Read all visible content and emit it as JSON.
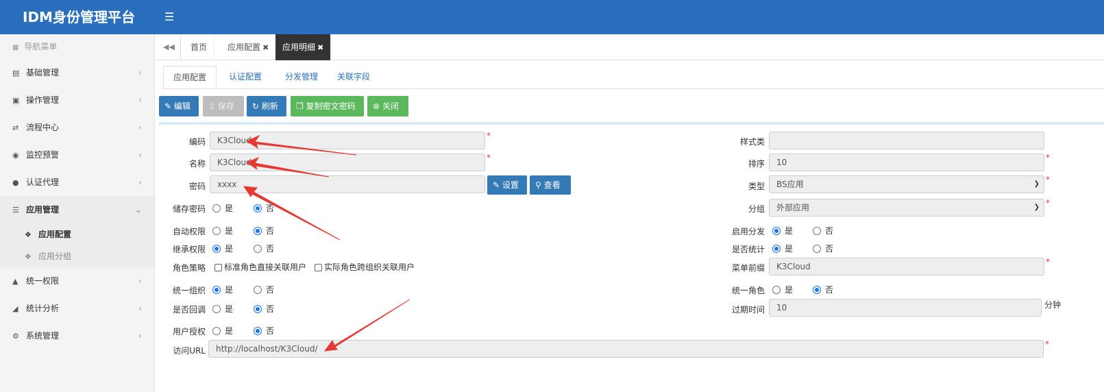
{
  "app": {
    "title": "IDM身份管理平台",
    "menu_icon": "hamburger-icon"
  },
  "sidebar": {
    "header": "导航菜单",
    "items": [
      {
        "label": "基础管理",
        "icon": "id-card-icon"
      },
      {
        "label": "操作管理",
        "icon": "book-icon"
      },
      {
        "label": "流程中心",
        "icon": "shuffle-icon"
      },
      {
        "label": "监控预警",
        "icon": "eye-icon"
      },
      {
        "label": "认证代理",
        "icon": "users-icon"
      },
      {
        "label": "应用管理",
        "icon": "list-icon",
        "expanded": true
      },
      {
        "label": "统一权限",
        "icon": "sitemap-icon"
      },
      {
        "label": "统计分析",
        "icon": "chart-icon"
      },
      {
        "label": "系统管理",
        "icon": "cogs-icon"
      }
    ],
    "subitems": [
      {
        "label": "应用配置",
        "active": true
      },
      {
        "label": "应用分组",
        "active": false
      }
    ]
  },
  "tabs": {
    "back_icon": "double-left-icon",
    "items": [
      {
        "label": "首页",
        "closable": false
      },
      {
        "label": "应用配置",
        "closable": true
      },
      {
        "label": "应用明细",
        "closable": true,
        "active": true
      }
    ],
    "close_glyph": "✖"
  },
  "subtabs": [
    "应用配置",
    "认证配置",
    "分发管理",
    "关联字段"
  ],
  "toolbar": {
    "edit": "编辑",
    "save": "保存",
    "refresh": "刷新",
    "copy_cipher": "复制密文密码",
    "close": "关闭"
  },
  "form": {
    "code": {
      "label": "编码",
      "value": "K3Cloud",
      "required": true
    },
    "name": {
      "label": "名称",
      "value": "K3Cloud",
      "required": true
    },
    "password": {
      "label": "密码",
      "value": "xxxx",
      "set_button": "设置",
      "view_button": "查看"
    },
    "store_password": {
      "label": "储存密码",
      "selected": "否"
    },
    "auto_permission": {
      "label": "自动权限",
      "selected": "否"
    },
    "inherit_permission": {
      "label": "继承权限",
      "selected": "是"
    },
    "role_strategy": {
      "label": "角色策略",
      "options": [
        "标准角色直接关联用户",
        "实际角色跨组织关联用户"
      ]
    },
    "unified_org": {
      "label": "统一组织",
      "selected": "是"
    },
    "callback": {
      "label": "是否回调",
      "selected": "否"
    },
    "user_auth": {
      "label": "用户授权",
      "selected": "否"
    },
    "url": {
      "label": "访问URL",
      "value": "http://localhost/K3Cloud/",
      "required": true
    },
    "style_class": {
      "label": "样式类",
      "value": ""
    },
    "sort": {
      "label": "排序",
      "value": "10",
      "required": true
    },
    "type": {
      "label": "类型",
      "value": "BS应用",
      "required": true
    },
    "group": {
      "label": "分组",
      "value": "外部应用",
      "required": true
    },
    "enable_dist": {
      "label": "启用分发",
      "selected": "是"
    },
    "statistics": {
      "label": "是否统计",
      "selected": "是"
    },
    "menu_prefix": {
      "label": "菜单前缀",
      "value": "K3Cloud",
      "required": true
    },
    "unified_role": {
      "label": "统一角色",
      "selected": "否"
    },
    "expire_time": {
      "label": "过期时间",
      "value": "10",
      "unit": "分钟"
    },
    "yes": "是",
    "no": "否",
    "required_mark": "*"
  },
  "colors": {
    "topbar": "#2a6fbd",
    "primary": "#337ab7",
    "success": "#5cb85c",
    "annotation_arrow": "#e53935"
  }
}
